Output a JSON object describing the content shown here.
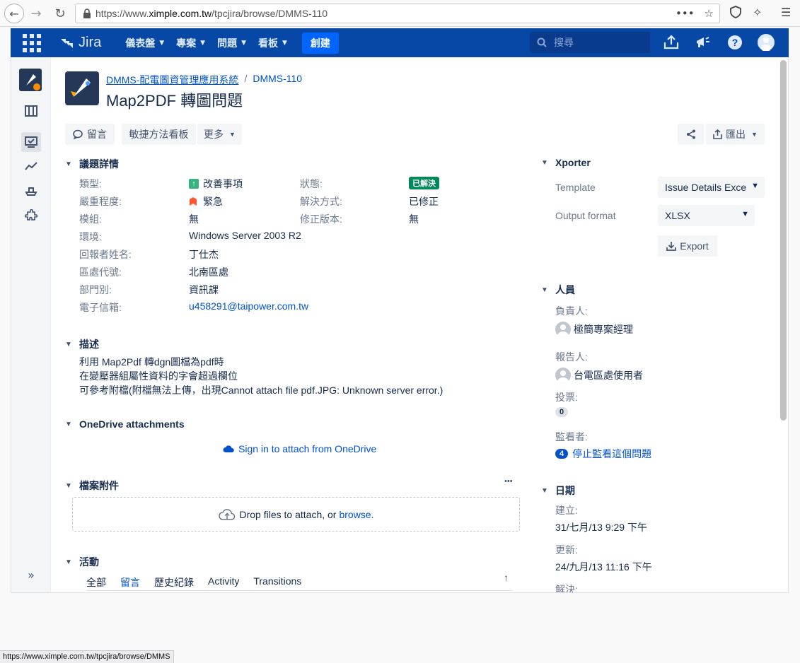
{
  "browser": {
    "url_prefix": "https://www.",
    "url_host": "ximple.com.tw",
    "url_path": "/tpcjira/browse/DMMS-110",
    "status_url": "https://www.ximple.com.tw/tpcjira/browse/DMMS"
  },
  "header": {
    "logo_text": "Jira",
    "nav": [
      "儀表盤",
      "專案",
      "問題",
      "看板"
    ],
    "create_label": "創建",
    "search_placeholder": "搜尋"
  },
  "breadcrumb": {
    "project": "DMMS-配電圖資管理應用系統",
    "separator": "/",
    "issue_key": "DMMS-110"
  },
  "issue": {
    "title": "Map2PDF 轉圖問題"
  },
  "toolbar": {
    "comment": "留言",
    "agile_board": "敏捷方法看板",
    "more": "更多",
    "export": "匯出"
  },
  "details": {
    "heading": "議題詳情",
    "fields": [
      {
        "label": "類型:",
        "value": "改善事項"
      },
      {
        "label": "嚴重程度:",
        "value": "緊急"
      },
      {
        "label": "模組:",
        "value": "無"
      },
      {
        "label": "環境:",
        "value": "Windows Server 2003 R2"
      },
      {
        "label": "回報者姓名:",
        "value": "丁仕杰"
      },
      {
        "label": "區處代號:",
        "value": "北南區處"
      },
      {
        "label": "部門別:",
        "value": "資訊課"
      },
      {
        "label": "電子信箱:",
        "value": "u458291@taipower.com.tw"
      }
    ],
    "right_fields": [
      {
        "label": "狀態:",
        "value": "已解決"
      },
      {
        "label": "解決方式:",
        "value": "已修正"
      },
      {
        "label": "修正版本:",
        "value": "無"
      }
    ]
  },
  "description": {
    "heading": "描述",
    "lines": [
      "利用 Map2Pdf 轉dgn圖檔為pdf時",
      "在變壓器組屬性資料的字會超過欄位",
      "可參考附檔(附檔無法上傳，出現Cannot attach file pdf.JPG: Unknown server error.)"
    ]
  },
  "onedrive": {
    "heading": "OneDrive attachments",
    "signin": "Sign in to attach from OneDrive"
  },
  "attachments": {
    "heading": "檔案附件",
    "drop_text": "Drop files to attach, or ",
    "browse": "browse.",
    "more": "•••"
  },
  "activity": {
    "heading": "活動",
    "tabs": [
      "全部",
      "留言",
      "歷史紀錄",
      "Activity",
      "Transitions"
    ],
    "active_tab": 1
  },
  "xporter": {
    "heading": "Xporter",
    "template_label": "Template",
    "template_value": "Issue Details Exce",
    "format_label": "Output format",
    "format_value": "XLSX",
    "export_button": "Export"
  },
  "people": {
    "heading": "人員",
    "assignee_label": "負責人:",
    "assignee": "極簡專案經理",
    "reporter_label": "報告人:",
    "reporter": "台電區處使用者",
    "votes_label": "投票:",
    "votes": "0",
    "watchers_label": "監看者:",
    "watchers_count": "4",
    "watch_link": "停止監看這個問題"
  },
  "dates": {
    "heading": "日期",
    "created_label": "建立:",
    "created": "31/七月/13 9:29 下午",
    "updated_label": "更新:",
    "updated": "24/九月/13 11:16 下午",
    "resolved_label": "解決:"
  },
  "colors": {
    "header_bg": "#0747a6",
    "create_bg": "#0065ff",
    "link": "#0052cc",
    "status_done": "#00875a",
    "improvement": "#36b37e",
    "priority": "#ff5630"
  }
}
